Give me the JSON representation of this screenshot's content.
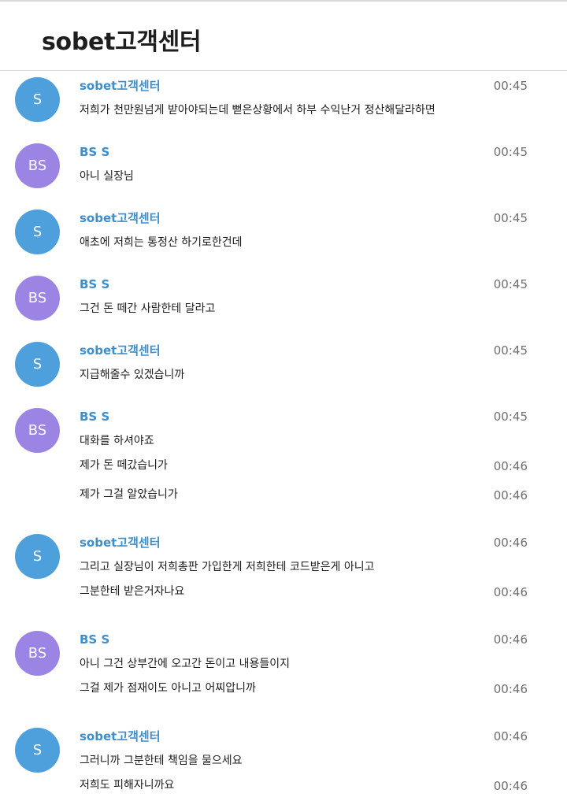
{
  "header": {
    "title": "sobet고객센터"
  },
  "colors": {
    "agent_avatar": "#4ea0dc",
    "user_avatar": "#9b84e3",
    "name_text": "#3d8fcc",
    "time_text": "#6f6f6f"
  },
  "messages": [
    {
      "sender": "sobet고객센터",
      "initials": "S",
      "time": "00:45",
      "text": "저희가 천만원넘게 받아야되는데 뻗은상황에서 하부 수익난거 정산해달라하면"
    },
    {
      "sender": "BS S",
      "initials": "BS",
      "time": "00:45",
      "text": "아니 실장님"
    },
    {
      "sender": "sobet고객센터",
      "initials": "S",
      "time": "00:45",
      "text": "애초에 저희는 통정산 하기로한건데"
    },
    {
      "sender": "BS S",
      "initials": "BS",
      "time": "00:45",
      "text": "그건 돈 떼간 사람한테 달라고"
    },
    {
      "sender": "sobet고객센터",
      "initials": "S",
      "time": "00:45",
      "text": "지급해줄수 있겠습니까"
    },
    {
      "sender": "BS S",
      "initials": "BS",
      "time": "00:45",
      "text": "대화를 하셔야죠"
    },
    {
      "time": "00:46",
      "text": "제가 돈 떼갔습니가"
    },
    {
      "time": "00:46",
      "text": "제가 그걸 알았습니가"
    },
    {
      "sender": "sobet고객센터",
      "initials": "S",
      "time": "00:46",
      "text": "그리고 실장님이 저희총판 가입한게 저희한테 코드받은게 아니고"
    },
    {
      "time": "00:46",
      "text": "그분한테 받은거자나요"
    },
    {
      "sender": "BS S",
      "initials": "BS",
      "time": "00:46",
      "text": "아니 그건 상부간에 오고간 돈이고 내용들이지"
    },
    {
      "time": "00:46",
      "text": "그걸 제가 점재이도 아니고 어찌압니까"
    },
    {
      "sender": "sobet고객센터",
      "initials": "S",
      "time": "00:46",
      "text": "그러니까 그분한테 책임을 물으세요"
    },
    {
      "time": "00:46",
      "text": "저희도 피해자니까요"
    }
  ]
}
